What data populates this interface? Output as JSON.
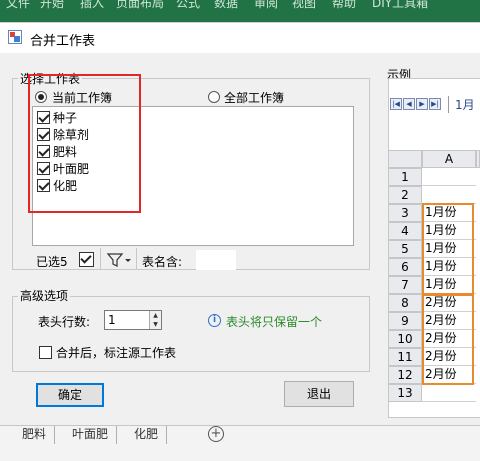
{
  "excel_ribbon": {
    "tabs": [
      "文件",
      "开始",
      "插入",
      "页面布局",
      "公式",
      "数据",
      "审阅",
      "视图",
      "帮助",
      "DIY工具箱"
    ]
  },
  "dialog": {
    "title": "合并工作表",
    "select_group": {
      "legend": "选择工作表",
      "radio_current": "当前工作簿",
      "radio_all": "全部工作簿",
      "items": [
        {
          "label": "种子",
          "checked": true
        },
        {
          "label": "除草剂",
          "checked": true
        },
        {
          "label": "肥料",
          "checked": true
        },
        {
          "label": "叶面肥",
          "checked": true
        },
        {
          "label": "化肥",
          "checked": true
        }
      ],
      "selected_count": "已选5",
      "sheet_name_label": "表名含:"
    },
    "advanced_group": {
      "legend": "高级选项",
      "header_rows_label": "表头行数:",
      "header_rows_value": "1",
      "info_text": "表头将只保留一个",
      "mark_source_label": "合并后，标注源工作表"
    },
    "buttons": {
      "ok": "确定",
      "exit": "退出"
    },
    "preview": {
      "legend": "示例",
      "sheet_tab": "1月",
      "column_header": "A",
      "rows": [
        {
          "n": "1",
          "v": ""
        },
        {
          "n": "2",
          "v": ""
        },
        {
          "n": "3",
          "v": "1月份"
        },
        {
          "n": "4",
          "v": "1月份"
        },
        {
          "n": "5",
          "v": "1月份"
        },
        {
          "n": "6",
          "v": "1月份"
        },
        {
          "n": "7",
          "v": "1月份"
        },
        {
          "n": "8",
          "v": "2月份"
        },
        {
          "n": "9",
          "v": "2月份"
        },
        {
          "n": "10",
          "v": "2月份"
        },
        {
          "n": "11",
          "v": "2月份"
        },
        {
          "n": "12",
          "v": "2月份"
        },
        {
          "n": "13",
          "v": ""
        }
      ]
    }
  },
  "sheet_tabs": [
    "肥料",
    "叶面肥",
    "化肥"
  ],
  "colors": {
    "highlight_red": "#e02828",
    "highlight_orange": "#e88a2e",
    "info_green": "#2a8a2a",
    "excel_green": "#217346"
  }
}
